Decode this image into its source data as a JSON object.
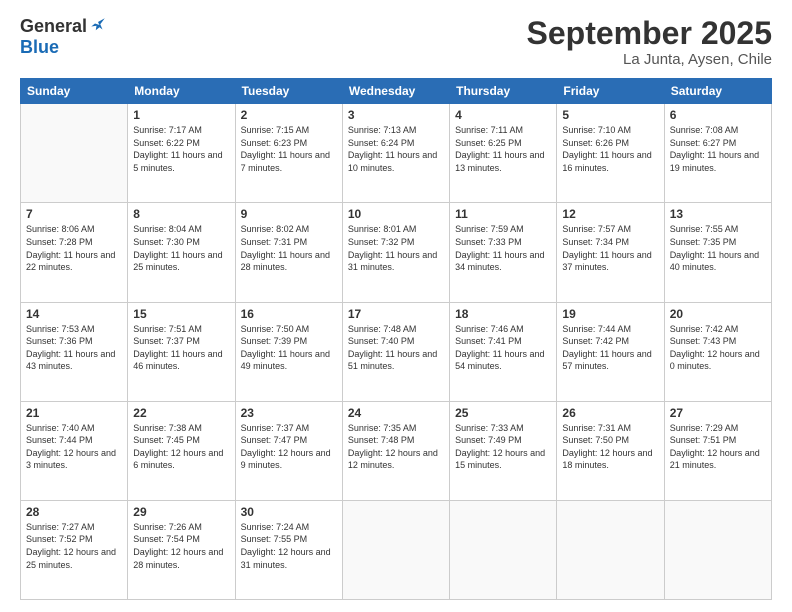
{
  "header": {
    "logo_general": "General",
    "logo_blue": "Blue",
    "month_title": "September 2025",
    "location": "La Junta, Aysen, Chile"
  },
  "days_of_week": [
    "Sunday",
    "Monday",
    "Tuesday",
    "Wednesday",
    "Thursday",
    "Friday",
    "Saturday"
  ],
  "weeks": [
    [
      {
        "day": "",
        "sunrise": "",
        "sunset": "",
        "daylight": ""
      },
      {
        "day": "1",
        "sunrise": "Sunrise: 7:17 AM",
        "sunset": "Sunset: 6:22 PM",
        "daylight": "Daylight: 11 hours and 5 minutes."
      },
      {
        "day": "2",
        "sunrise": "Sunrise: 7:15 AM",
        "sunset": "Sunset: 6:23 PM",
        "daylight": "Daylight: 11 hours and 7 minutes."
      },
      {
        "day": "3",
        "sunrise": "Sunrise: 7:13 AM",
        "sunset": "Sunset: 6:24 PM",
        "daylight": "Daylight: 11 hours and 10 minutes."
      },
      {
        "day": "4",
        "sunrise": "Sunrise: 7:11 AM",
        "sunset": "Sunset: 6:25 PM",
        "daylight": "Daylight: 11 hours and 13 minutes."
      },
      {
        "day": "5",
        "sunrise": "Sunrise: 7:10 AM",
        "sunset": "Sunset: 6:26 PM",
        "daylight": "Daylight: 11 hours and 16 minutes."
      },
      {
        "day": "6",
        "sunrise": "Sunrise: 7:08 AM",
        "sunset": "Sunset: 6:27 PM",
        "daylight": "Daylight: 11 hours and 19 minutes."
      }
    ],
    [
      {
        "day": "7",
        "sunrise": "Sunrise: 8:06 AM",
        "sunset": "Sunset: 7:28 PM",
        "daylight": "Daylight: 11 hours and 22 minutes."
      },
      {
        "day": "8",
        "sunrise": "Sunrise: 8:04 AM",
        "sunset": "Sunset: 7:30 PM",
        "daylight": "Daylight: 11 hours and 25 minutes."
      },
      {
        "day": "9",
        "sunrise": "Sunrise: 8:02 AM",
        "sunset": "Sunset: 7:31 PM",
        "daylight": "Daylight: 11 hours and 28 minutes."
      },
      {
        "day": "10",
        "sunrise": "Sunrise: 8:01 AM",
        "sunset": "Sunset: 7:32 PM",
        "daylight": "Daylight: 11 hours and 31 minutes."
      },
      {
        "day": "11",
        "sunrise": "Sunrise: 7:59 AM",
        "sunset": "Sunset: 7:33 PM",
        "daylight": "Daylight: 11 hours and 34 minutes."
      },
      {
        "day": "12",
        "sunrise": "Sunrise: 7:57 AM",
        "sunset": "Sunset: 7:34 PM",
        "daylight": "Daylight: 11 hours and 37 minutes."
      },
      {
        "day": "13",
        "sunrise": "Sunrise: 7:55 AM",
        "sunset": "Sunset: 7:35 PM",
        "daylight": "Daylight: 11 hours and 40 minutes."
      }
    ],
    [
      {
        "day": "14",
        "sunrise": "Sunrise: 7:53 AM",
        "sunset": "Sunset: 7:36 PM",
        "daylight": "Daylight: 11 hours and 43 minutes."
      },
      {
        "day": "15",
        "sunrise": "Sunrise: 7:51 AM",
        "sunset": "Sunset: 7:37 PM",
        "daylight": "Daylight: 11 hours and 46 minutes."
      },
      {
        "day": "16",
        "sunrise": "Sunrise: 7:50 AM",
        "sunset": "Sunset: 7:39 PM",
        "daylight": "Daylight: 11 hours and 49 minutes."
      },
      {
        "day": "17",
        "sunrise": "Sunrise: 7:48 AM",
        "sunset": "Sunset: 7:40 PM",
        "daylight": "Daylight: 11 hours and 51 minutes."
      },
      {
        "day": "18",
        "sunrise": "Sunrise: 7:46 AM",
        "sunset": "Sunset: 7:41 PM",
        "daylight": "Daylight: 11 hours and 54 minutes."
      },
      {
        "day": "19",
        "sunrise": "Sunrise: 7:44 AM",
        "sunset": "Sunset: 7:42 PM",
        "daylight": "Daylight: 11 hours and 57 minutes."
      },
      {
        "day": "20",
        "sunrise": "Sunrise: 7:42 AM",
        "sunset": "Sunset: 7:43 PM",
        "daylight": "Daylight: 12 hours and 0 minutes."
      }
    ],
    [
      {
        "day": "21",
        "sunrise": "Sunrise: 7:40 AM",
        "sunset": "Sunset: 7:44 PM",
        "daylight": "Daylight: 12 hours and 3 minutes."
      },
      {
        "day": "22",
        "sunrise": "Sunrise: 7:38 AM",
        "sunset": "Sunset: 7:45 PM",
        "daylight": "Daylight: 12 hours and 6 minutes."
      },
      {
        "day": "23",
        "sunrise": "Sunrise: 7:37 AM",
        "sunset": "Sunset: 7:47 PM",
        "daylight": "Daylight: 12 hours and 9 minutes."
      },
      {
        "day": "24",
        "sunrise": "Sunrise: 7:35 AM",
        "sunset": "Sunset: 7:48 PM",
        "daylight": "Daylight: 12 hours and 12 minutes."
      },
      {
        "day": "25",
        "sunrise": "Sunrise: 7:33 AM",
        "sunset": "Sunset: 7:49 PM",
        "daylight": "Daylight: 12 hours and 15 minutes."
      },
      {
        "day": "26",
        "sunrise": "Sunrise: 7:31 AM",
        "sunset": "Sunset: 7:50 PM",
        "daylight": "Daylight: 12 hours and 18 minutes."
      },
      {
        "day": "27",
        "sunrise": "Sunrise: 7:29 AM",
        "sunset": "Sunset: 7:51 PM",
        "daylight": "Daylight: 12 hours and 21 minutes."
      }
    ],
    [
      {
        "day": "28",
        "sunrise": "Sunrise: 7:27 AM",
        "sunset": "Sunset: 7:52 PM",
        "daylight": "Daylight: 12 hours and 25 minutes."
      },
      {
        "day": "29",
        "sunrise": "Sunrise: 7:26 AM",
        "sunset": "Sunset: 7:54 PM",
        "daylight": "Daylight: 12 hours and 28 minutes."
      },
      {
        "day": "30",
        "sunrise": "Sunrise: 7:24 AM",
        "sunset": "Sunset: 7:55 PM",
        "daylight": "Daylight: 12 hours and 31 minutes."
      },
      {
        "day": "",
        "sunrise": "",
        "sunset": "",
        "daylight": ""
      },
      {
        "day": "",
        "sunrise": "",
        "sunset": "",
        "daylight": ""
      },
      {
        "day": "",
        "sunrise": "",
        "sunset": "",
        "daylight": ""
      },
      {
        "day": "",
        "sunrise": "",
        "sunset": "",
        "daylight": ""
      }
    ]
  ]
}
